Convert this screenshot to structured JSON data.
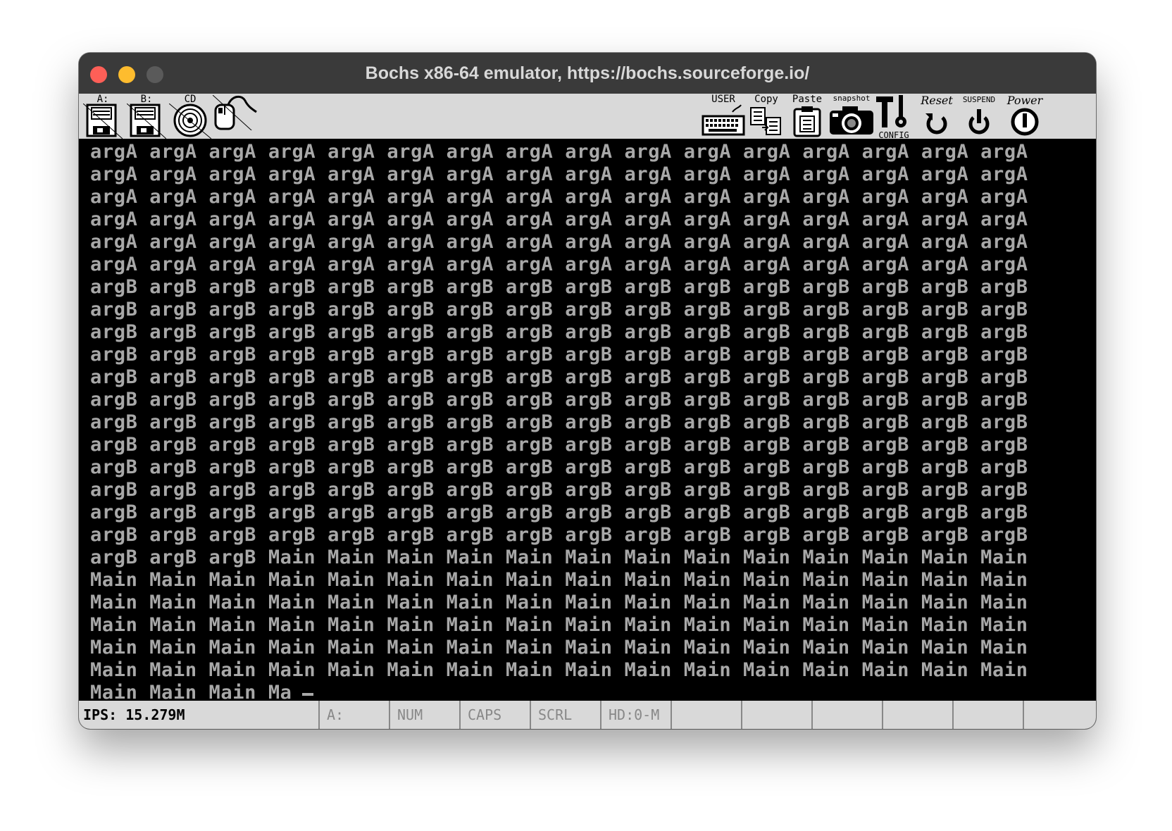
{
  "window": {
    "title": "Bochs x86-64 emulator, https://bochs.sourceforge.io/"
  },
  "toolbar": {
    "floppy_a_label": "A:",
    "floppy_b_label": "B:",
    "cdrom_label": "CD",
    "user_label": "USER",
    "copy_label": "Copy",
    "paste_label": "Paste",
    "snapshot_label": "snapshot",
    "config_label": "CONFIG",
    "reset_label": "Reset",
    "suspend_label": "SUSPEND",
    "power_label": "Power"
  },
  "screen": {
    "lines": [
      "argA argA argA argA argA argA argA argA argA argA argA argA argA argA argA argA",
      "argA argA argA argA argA argA argA argA argA argA argA argA argA argA argA argA",
      "argA argA argA argA argA argA argA argA argA argA argA argA argA argA argA argA",
      "argA argA argA argA argA argA argA argA argA argA argA argA argA argA argA argA",
      "argA argA argA argA argA argA argA argA argA argA argA argA argA argA argA argA",
      "argA argA argA argA argA argA argA argA argA argA argA argA argA argA argA argA",
      "argB argB argB argB argB argB argB argB argB argB argB argB argB argB argB argB",
      "argB argB argB argB argB argB argB argB argB argB argB argB argB argB argB argB",
      "argB argB argB argB argB argB argB argB argB argB argB argB argB argB argB argB",
      "argB argB argB argB argB argB argB argB argB argB argB argB argB argB argB argB",
      "argB argB argB argB argB argB argB argB argB argB argB argB argB argB argB argB",
      "argB argB argB argB argB argB argB argB argB argB argB argB argB argB argB argB",
      "argB argB argB argB argB argB argB argB argB argB argB argB argB argB argB argB",
      "argB argB argB argB argB argB argB argB argB argB argB argB argB argB argB argB",
      "argB argB argB argB argB argB argB argB argB argB argB argB argB argB argB argB",
      "argB argB argB argB argB argB argB argB argB argB argB argB argB argB argB argB",
      "argB argB argB argB argB argB argB argB argB argB argB argB argB argB argB argB",
      "argB argB argB argB argB argB argB argB argB argB argB argB argB argB argB argB",
      "argB argB argB Main Main Main Main Main Main Main Main Main Main Main Main Main",
      "Main Main Main Main Main Main Main Main Main Main Main Main Main Main Main Main",
      "Main Main Main Main Main Main Main Main Main Main Main Main Main Main Main Main",
      "Main Main Main Main Main Main Main Main Main Main Main Main Main Main Main Main",
      "Main Main Main Main Main Main Main Main Main Main Main Main Main Main Main Main",
      "Main Main Main Main Main Main Main Main Main Main Main Main Main Main Main Main",
      "Main Main Main Ma"
    ]
  },
  "statusbar": {
    "ips": "IPS: 15.279M",
    "cells": [
      "A:",
      "NUM",
      "CAPS",
      "SCRL",
      "HD:0-M",
      "",
      "",
      "",
      "",
      ""
    ]
  }
}
